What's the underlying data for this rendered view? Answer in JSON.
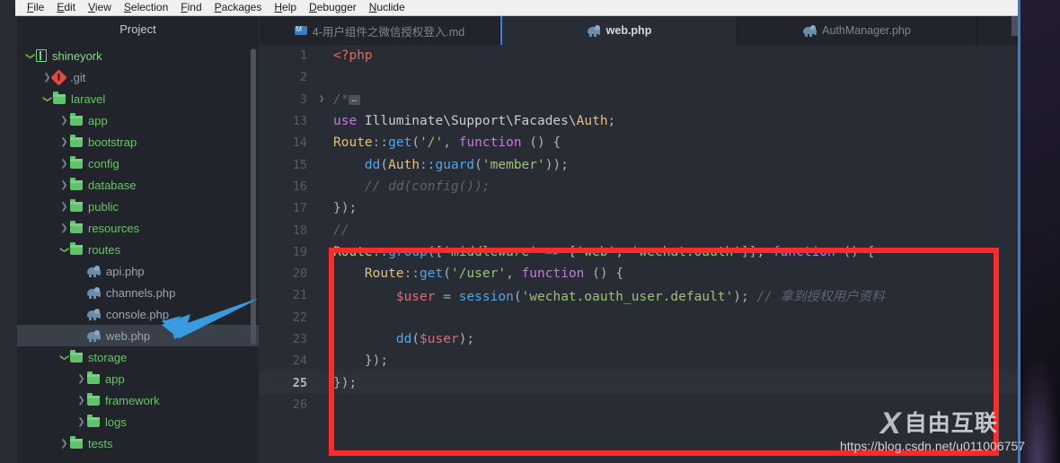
{
  "menubar": {
    "items": [
      {
        "label": "File",
        "accel": "F"
      },
      {
        "label": "Edit",
        "accel": "E"
      },
      {
        "label": "View",
        "accel": "V"
      },
      {
        "label": "Selection",
        "accel": "S"
      },
      {
        "label": "Find",
        "accel": "F"
      },
      {
        "label": "Packages",
        "accel": "P"
      },
      {
        "label": "Help",
        "accel": "H"
      },
      {
        "label": "Debugger",
        "accel": "D"
      },
      {
        "label": "Nuclide",
        "accel": "N"
      }
    ]
  },
  "sidebar": {
    "title": "Project",
    "tree": [
      {
        "label": "shineyork",
        "icon": "book-icon",
        "indent": 0,
        "arrow": "open",
        "type": "root",
        "selected": false
      },
      {
        "label": ".git",
        "icon": "git-icon",
        "indent": 1,
        "arrow": "closed",
        "type": "git",
        "selected": false
      },
      {
        "label": "laravel",
        "icon": "folder-icon",
        "indent": 1,
        "arrow": "open",
        "type": "folder",
        "selected": false
      },
      {
        "label": "app",
        "icon": "folder-icon",
        "indent": 2,
        "arrow": "closed",
        "type": "folder",
        "selected": false
      },
      {
        "label": "bootstrap",
        "icon": "folder-icon",
        "indent": 2,
        "arrow": "closed",
        "type": "folder",
        "selected": false
      },
      {
        "label": "config",
        "icon": "folder-icon",
        "indent": 2,
        "arrow": "closed",
        "type": "folder",
        "selected": false
      },
      {
        "label": "database",
        "icon": "folder-icon",
        "indent": 2,
        "arrow": "closed",
        "type": "folder",
        "selected": false
      },
      {
        "label": "public",
        "icon": "folder-icon",
        "indent": 2,
        "arrow": "closed",
        "type": "folder",
        "selected": false
      },
      {
        "label": "resources",
        "icon": "folder-icon",
        "indent": 2,
        "arrow": "closed",
        "type": "folder",
        "selected": false
      },
      {
        "label": "routes",
        "icon": "folder-icon",
        "indent": 2,
        "arrow": "open",
        "type": "folder",
        "selected": false
      },
      {
        "label": "api.php",
        "icon": "php-file-icon",
        "indent": 3,
        "arrow": "none",
        "type": "file",
        "selected": false
      },
      {
        "label": "channels.php",
        "icon": "php-file-icon",
        "indent": 3,
        "arrow": "none",
        "type": "file",
        "selected": false
      },
      {
        "label": "console.php",
        "icon": "php-file-icon",
        "indent": 3,
        "arrow": "none",
        "type": "file",
        "selected": false
      },
      {
        "label": "web.php",
        "icon": "php-file-icon",
        "indent": 3,
        "arrow": "none",
        "type": "file",
        "selected": true
      },
      {
        "label": "storage",
        "icon": "folder-icon",
        "indent": 2,
        "arrow": "open",
        "type": "folder",
        "selected": false
      },
      {
        "label": "app",
        "icon": "folder-icon",
        "indent": 3,
        "arrow": "closed",
        "type": "folder",
        "selected": false
      },
      {
        "label": "framework",
        "icon": "folder-icon",
        "indent": 3,
        "arrow": "closed",
        "type": "folder",
        "selected": false
      },
      {
        "label": "logs",
        "icon": "folder-icon",
        "indent": 3,
        "arrow": "closed",
        "type": "folder",
        "selected": false
      },
      {
        "label": "tests",
        "icon": "folder-icon",
        "indent": 2,
        "arrow": "closed",
        "type": "folder",
        "selected": false
      }
    ]
  },
  "tabs": [
    {
      "label": "4-用户组件之微信授权登入.md",
      "icon": "markdown-icon",
      "active": false
    },
    {
      "label": "web.php",
      "icon": "php-file-icon",
      "active": true
    },
    {
      "label": "AuthManager.php",
      "icon": "php-file-icon",
      "active": false
    }
  ],
  "editor": {
    "active_line": 25,
    "lines": [
      {
        "num": "1",
        "fold": "",
        "active": false,
        "tokens": [
          {
            "t": "<?php",
            "c": "t-tag"
          }
        ]
      },
      {
        "num": "2",
        "fold": "",
        "active": false,
        "tokens": []
      },
      {
        "num": "3",
        "fold": "chevron-right-icon",
        "active": false,
        "tokens": [
          {
            "t": "/*",
            "c": "t-cmt"
          },
          {
            "t": "…",
            "c": "fold-chip"
          }
        ]
      },
      {
        "num": "13",
        "fold": "",
        "active": false,
        "tokens": [
          {
            "t": "use ",
            "c": "t-kw"
          },
          {
            "t": "Illuminate\\Support\\Facades\\",
            "c": "t-cls"
          },
          {
            "t": "Auth",
            "c": "t-const"
          },
          {
            "t": ";",
            "c": "t-punc"
          }
        ]
      },
      {
        "num": "14",
        "fold": "",
        "active": false,
        "tokens": [
          {
            "t": "Route",
            "c": "t-const"
          },
          {
            "t": "::",
            "c": "t-op"
          },
          {
            "t": "get",
            "c": "t-fn"
          },
          {
            "t": "(",
            "c": "t-punc"
          },
          {
            "t": "'/'",
            "c": "t-str"
          },
          {
            "t": ", ",
            "c": "t-punc"
          },
          {
            "t": "function",
            "c": "t-kw"
          },
          {
            "t": " () {",
            "c": "t-punc"
          }
        ]
      },
      {
        "num": "15",
        "fold": "",
        "active": false,
        "tokens": [
          {
            "t": "    ",
            "c": "t-plain"
          },
          {
            "t": "dd",
            "c": "t-fn"
          },
          {
            "t": "(",
            "c": "t-punc"
          },
          {
            "t": "Auth",
            "c": "t-const"
          },
          {
            "t": "::",
            "c": "t-op"
          },
          {
            "t": "guard",
            "c": "t-fn"
          },
          {
            "t": "(",
            "c": "t-punc"
          },
          {
            "t": "'member'",
            "c": "t-str"
          },
          {
            "t": "));",
            "c": "t-punc"
          }
        ]
      },
      {
        "num": "16",
        "fold": "",
        "active": false,
        "tokens": [
          {
            "t": "    // dd(config());",
            "c": "t-cmt"
          }
        ]
      },
      {
        "num": "17",
        "fold": "",
        "active": false,
        "tokens": [
          {
            "t": "});",
            "c": "t-punc"
          }
        ]
      },
      {
        "num": "18",
        "fold": "",
        "active": false,
        "tokens": [
          {
            "t": "//",
            "c": "t-cmt"
          }
        ]
      },
      {
        "num": "19",
        "fold": "",
        "active": false,
        "tokens": [
          {
            "t": "Route",
            "c": "t-const"
          },
          {
            "t": "::",
            "c": "t-op"
          },
          {
            "t": "group",
            "c": "t-fn"
          },
          {
            "t": "([",
            "c": "t-punc"
          },
          {
            "t": "'middleware'",
            "c": "t-str"
          },
          {
            "t": " => ",
            "c": "t-op"
          },
          {
            "t": "[",
            "c": "t-punc"
          },
          {
            "t": "'web'",
            "c": "t-str"
          },
          {
            "t": ", ",
            "c": "t-punc"
          },
          {
            "t": "'wechat.oauth'",
            "c": "t-str"
          },
          {
            "t": "]], ",
            "c": "t-punc"
          },
          {
            "t": "function",
            "c": "t-kw"
          },
          {
            "t": " () {",
            "c": "t-punc"
          }
        ]
      },
      {
        "num": "20",
        "fold": "",
        "active": false,
        "tokens": [
          {
            "t": "    ",
            "c": "t-plain"
          },
          {
            "t": "Route",
            "c": "t-const"
          },
          {
            "t": "::",
            "c": "t-op"
          },
          {
            "t": "get",
            "c": "t-fn"
          },
          {
            "t": "(",
            "c": "t-punc"
          },
          {
            "t": "'/user'",
            "c": "t-str"
          },
          {
            "t": ", ",
            "c": "t-punc"
          },
          {
            "t": "function",
            "c": "t-kw"
          },
          {
            "t": " () {",
            "c": "t-punc"
          }
        ]
      },
      {
        "num": "21",
        "fold": "",
        "active": false,
        "tokens": [
          {
            "t": "        ",
            "c": "t-plain"
          },
          {
            "t": "$user",
            "c": "t-var"
          },
          {
            "t": " = ",
            "c": "t-op"
          },
          {
            "t": "session",
            "c": "t-fn"
          },
          {
            "t": "(",
            "c": "t-punc"
          },
          {
            "t": "'wechat.oauth_user.default'",
            "c": "t-str"
          },
          {
            "t": "); ",
            "c": "t-punc"
          },
          {
            "t": "// 拿到授权用户资料",
            "c": "t-cmt"
          }
        ]
      },
      {
        "num": "22",
        "fold": "",
        "active": false,
        "tokens": []
      },
      {
        "num": "23",
        "fold": "",
        "active": false,
        "tokens": [
          {
            "t": "        ",
            "c": "t-plain"
          },
          {
            "t": "dd",
            "c": "t-fn"
          },
          {
            "t": "(",
            "c": "t-punc"
          },
          {
            "t": "$user",
            "c": "t-var"
          },
          {
            "t": ");",
            "c": "t-punc"
          }
        ]
      },
      {
        "num": "24",
        "fold": "",
        "active": false,
        "tokens": [
          {
            "t": "    });",
            "c": "t-punc"
          }
        ]
      },
      {
        "num": "25",
        "fold": "",
        "active": true,
        "tokens": [
          {
            "t": "});",
            "c": "t-punc"
          }
        ]
      },
      {
        "num": "26",
        "fold": "",
        "active": false,
        "tokens": []
      }
    ]
  },
  "annotations": {
    "red_box_color": "#fd2a2a",
    "blue_arrow_color": "#3a9ae0",
    "blue_arrow_target": "web.php"
  },
  "watermark": {
    "logo_mark": "X",
    "logo_text": "自由互联",
    "url": "https://blog.csdn.net/u011006757"
  }
}
